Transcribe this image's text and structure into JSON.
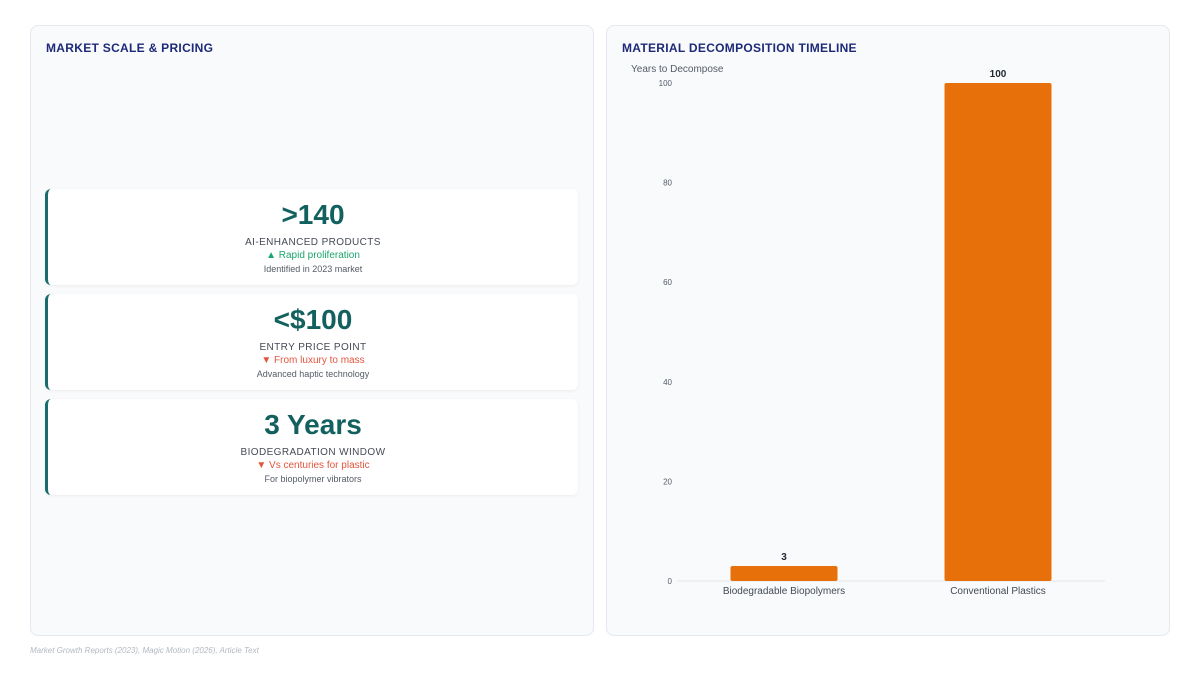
{
  "left_panel": {
    "title": "MARKET SCALE & PRICING",
    "cards": [
      {
        "value": ">140",
        "label": "AI-ENHANCED PRODUCTS",
        "trend_icon": "▲",
        "trend_text": "Rapid proliferation",
        "trend_direction": "up",
        "note": "Identified in 2023 market"
      },
      {
        "value": "<$100",
        "label": "ENTRY PRICE POINT",
        "trend_icon": "▼",
        "trend_text": "From luxury to mass",
        "trend_direction": "down",
        "note": "Advanced haptic technology"
      },
      {
        "value": "3 Years",
        "label": "BIODEGRADATION WINDOW",
        "trend_icon": "▼",
        "trend_text": "Vs centuries for plastic",
        "trend_direction": "down",
        "note": "For biopolymer vibrators"
      }
    ]
  },
  "right_panel": {
    "title": "MATERIAL DECOMPOSITION TIMELINE"
  },
  "chart_data": {
    "type": "bar",
    "title": "MATERIAL DECOMPOSITION TIMELINE",
    "ylabel": "Years to Decompose",
    "xlabel": "",
    "categories": [
      "Biodegradable Biopolymers",
      "Conventional Plastics"
    ],
    "values": [
      3,
      100
    ],
    "ylim": [
      0,
      100
    ],
    "yticks": [
      0,
      20,
      40,
      60,
      80,
      100
    ],
    "bar_color": "#e8700a",
    "grid": false,
    "data_labels": true
  },
  "footer": {
    "source": "Market Growth Reports (2023), Magic Motion (2026), Article Text"
  }
}
